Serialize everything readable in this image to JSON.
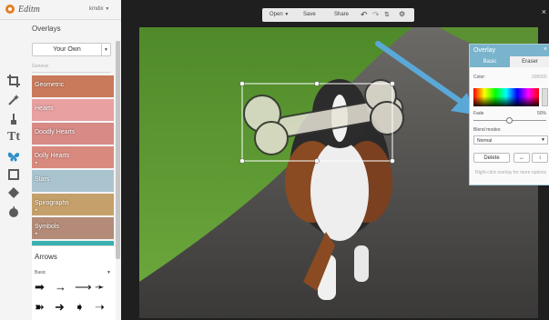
{
  "app": {
    "brand": "Editm",
    "user": "kmdix",
    "close": "×"
  },
  "toolbar": {
    "open": "Open",
    "save": "Save",
    "share": "Share"
  },
  "overlays": {
    "title": "Overlays",
    "selected_set": "Your Own",
    "category": "General",
    "items": [
      {
        "label": "Geometric",
        "color": "#c97a5a",
        "badge": ""
      },
      {
        "label": "Hearts",
        "color": "#e8a0a0",
        "badge": ""
      },
      {
        "label": "Doodly Hearts",
        "color": "#d88a86",
        "badge": ""
      },
      {
        "label": "Dolly Hearts",
        "color": "#d98a7e",
        "badge": "★"
      },
      {
        "label": "Stars",
        "color": "#a9c4cf",
        "badge": ""
      },
      {
        "label": "Spirographs",
        "color": "#c6a06a",
        "badge": "★"
      },
      {
        "label": "Symbols",
        "color": "#b48a78",
        "badge": "★"
      },
      {
        "label": "",
        "color": "#3ab0b0",
        "badge": ""
      }
    ],
    "arrows_title": "Arrows",
    "arrows_subset": "Basic"
  },
  "overlay_panel": {
    "title": "Overlay",
    "tab_basic": "Basic",
    "tab_eraser": "Eraser",
    "color_label": "Color:",
    "color_value": "000000",
    "fade_label": "Fade",
    "fade_value": "50%",
    "fade_fraction": 0.5,
    "blend_label": "Blend modes:",
    "blend_value": "Normal",
    "delete_label": "Delete",
    "hint": "Right-click overlay for more options"
  },
  "colors": {
    "accent": "#79b3cc",
    "arrow_annotation": "#5aa8d8",
    "selection": "#ffffff"
  }
}
